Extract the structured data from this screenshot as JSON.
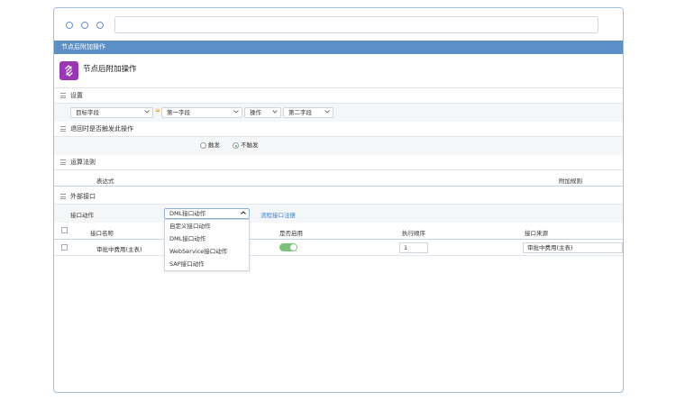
{
  "window_title": "节点后附加操作",
  "node": {
    "title": "节点后附加操作",
    "icon": "link-node-icon",
    "icon_color": "#9b37b5"
  },
  "sections": {
    "settings": "设置",
    "rollback": "退回时是否触发此操作",
    "rules": "运算法则",
    "external": "外部接口"
  },
  "settings_row": {
    "target_field": "目标字段",
    "first_field": "第一字段",
    "operation": "操作",
    "second_field": "第二字段",
    "equals_mark": "="
  },
  "rollback_row": {
    "trigger": "触发",
    "no_trigger": "不触发",
    "selected": "no_trigger"
  },
  "rules_header": {
    "expression": "表达式",
    "attached_rule": "附加规则"
  },
  "external_row": {
    "action_label": "接口动作",
    "action_value": "DML接口动作",
    "flow_register_link": "流程接口注册",
    "options": [
      "自定义接口动作",
      "DML接口动作",
      "WebService接口动作",
      "SAP接口动作"
    ]
  },
  "table": {
    "headers": {
      "name": "接口名称",
      "enabled": "是否启用",
      "order": "执行顺序",
      "source": "接口来源"
    },
    "rows": [
      {
        "name": "审批中费用(主表)",
        "enabled": true,
        "order": "1",
        "source": "审批中费用(主表)"
      }
    ]
  },
  "colors": {
    "titlebar": "#5b8fc5",
    "toggle_on": "#7ac27a",
    "link": "#2f7ed8"
  }
}
